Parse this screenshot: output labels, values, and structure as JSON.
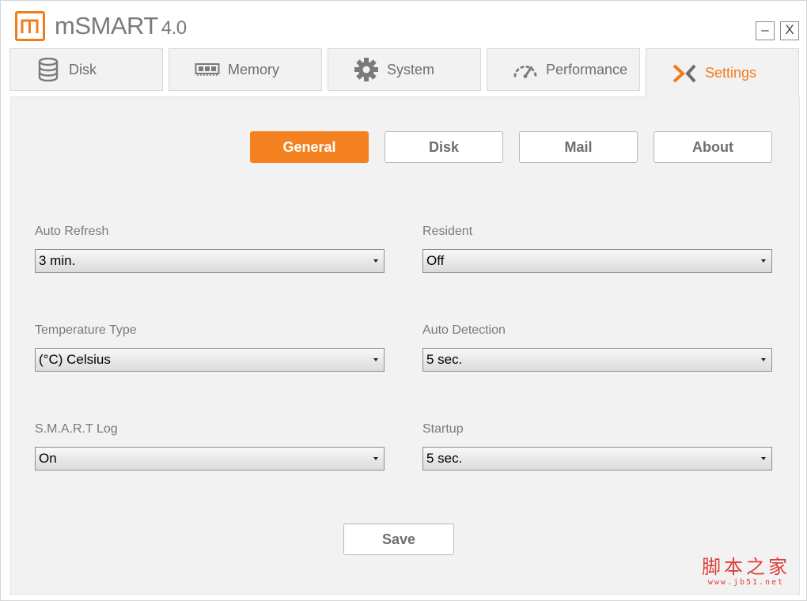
{
  "app": {
    "title": "mSMART",
    "version": "4.0",
    "minimize": "–",
    "close": "X"
  },
  "tabs": [
    {
      "label": "Disk",
      "icon": "database-icon"
    },
    {
      "label": "Memory",
      "icon": "memory-chip-icon"
    },
    {
      "label": "System",
      "icon": "gear-icon"
    },
    {
      "label": "Performance",
      "icon": "speedometer-icon"
    },
    {
      "label": "Settings",
      "icon": "settings-x-icon",
      "active": true
    }
  ],
  "subtabs": [
    {
      "label": "General",
      "active": true
    },
    {
      "label": "Disk"
    },
    {
      "label": "Mail"
    },
    {
      "label": "About"
    }
  ],
  "fields": {
    "auto_refresh": {
      "label": "Auto Refresh",
      "value": "3 min."
    },
    "resident": {
      "label": "Resident",
      "value": "Off"
    },
    "temperature_type": {
      "label": "Temperature Type",
      "value": "(°C) Celsius"
    },
    "auto_detection": {
      "label": "Auto Detection",
      "value": "5 sec."
    },
    "smart_log": {
      "label": "S.M.A.R.T Log",
      "value": "On"
    },
    "startup": {
      "label": "Startup",
      "value": "5 sec."
    }
  },
  "save_label": "Save",
  "colors": {
    "accent": "#f58220",
    "panel_bg": "#f2f2f2",
    "text_gray": "#6e6e6e"
  },
  "watermark": {
    "cn": "脚本之家",
    "url": "www.jb51.net"
  }
}
